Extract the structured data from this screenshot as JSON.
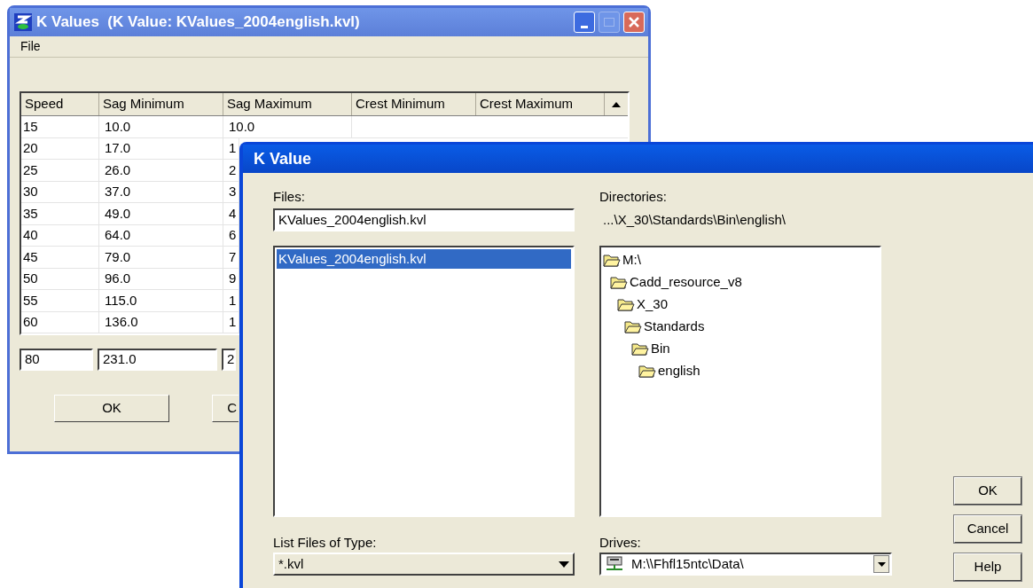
{
  "main_window": {
    "title": "K Values  (K Value: KValues_2004english.kvl)",
    "menu": [
      "File"
    ],
    "table": {
      "columns": [
        "Speed",
        "Sag Minimum",
        "Sag Maximum",
        "Crest Minimum",
        "Crest Maximum"
      ],
      "rows": [
        [
          "15",
          "10.0",
          "10.0"
        ],
        [
          "20",
          "17.0",
          "1"
        ],
        [
          "25",
          "26.0",
          "2"
        ],
        [
          "30",
          "37.0",
          "3"
        ],
        [
          "35",
          "49.0",
          "4"
        ],
        [
          "40",
          "64.0",
          "6"
        ],
        [
          "45",
          "79.0",
          "7"
        ],
        [
          "50",
          "96.0",
          "9"
        ],
        [
          "55",
          "115.0",
          "1"
        ],
        [
          "60",
          "136.0",
          "1"
        ]
      ],
      "edit_row": [
        "80",
        "231.0",
        "2"
      ]
    },
    "buttons": [
      "OK",
      "C"
    ]
  },
  "dialog": {
    "title": "K Value",
    "files_label": "Files:",
    "file_name": "KValues_2004english.kvl",
    "files": [
      {
        "name": "KValues_2004english.kvl",
        "selected": true
      }
    ],
    "directories_label": "Directories:",
    "current_path": "...\\X_30\\Standards\\Bin\\english\\",
    "directories": [
      {
        "name": "M:\\",
        "open": true,
        "children": [
          {
            "name": "Cadd_resource_v8",
            "open": true,
            "children": [
              {
                "name": "X_30",
                "open": true,
                "children": [
                  {
                    "name": "Standards",
                    "open": true,
                    "children": [
                      {
                        "name": "Bin",
                        "open": true,
                        "children": [
                          {
                            "name": "english",
                            "open": true
                          }
                        ]
                      }
                    ]
                  }
                ]
              }
            ]
          }
        ]
      }
    ],
    "type_label": "List Files of Type:",
    "type_value": "*.kvl",
    "drives_label": "Drives:",
    "drive_value": "M:\\\\Fhfl15ntc\\Data\\",
    "buttons": [
      "OK",
      "Cancel",
      "Help"
    ]
  }
}
